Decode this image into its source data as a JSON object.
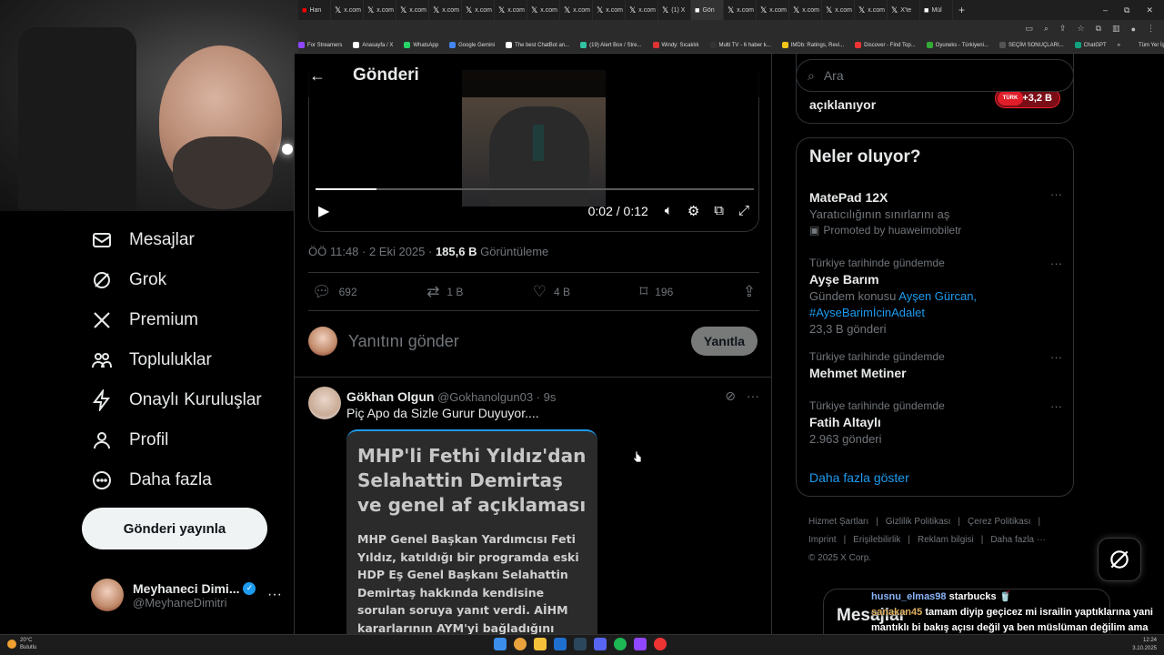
{
  "browser": {
    "tabs": [
      {
        "icon": "yt",
        "label": "Han",
        "color": "#ff0000"
      },
      {
        "icon": "x",
        "label": "x.com"
      },
      {
        "icon": "x",
        "label": "x.com"
      },
      {
        "icon": "x",
        "label": "x.com"
      },
      {
        "icon": "x",
        "label": "x.com"
      },
      {
        "icon": "x",
        "label": "x.com"
      },
      {
        "icon": "x",
        "label": "x.com"
      },
      {
        "icon": "x",
        "label": "x.com"
      },
      {
        "icon": "x",
        "label": "x.com"
      },
      {
        "icon": "x",
        "label": "x.com"
      },
      {
        "icon": "x",
        "label": "x.com"
      },
      {
        "icon": "x",
        "label": "(1) X"
      },
      {
        "icon": "g",
        "label": "Gön"
      },
      {
        "icon": "x",
        "label": "x.com"
      },
      {
        "icon": "x",
        "label": "x.com"
      },
      {
        "icon": "x",
        "label": "x.com"
      },
      {
        "icon": "x",
        "label": "x.com"
      },
      {
        "icon": "x",
        "label": "x.com"
      },
      {
        "icon": "x",
        "label": "X'te"
      },
      {
        "icon": "m",
        "label": "Mül"
      }
    ],
    "new_tab": "+",
    "window_controls": [
      "–",
      "⧉",
      "✕"
    ],
    "bookmarks": [
      {
        "label": "For Streamers",
        "color": "#9146ff"
      },
      {
        "label": "Anasayfa / X",
        "color": "#ffffff"
      },
      {
        "label": "WhatsApp",
        "color": "#25d366"
      },
      {
        "label": "Google Gemini",
        "color": "#4285f4"
      },
      {
        "label": "The best ChatBot an...",
        "color": "#ffffff"
      },
      {
        "label": "(19) Alert Box / Stre...",
        "color": "#31c3a2"
      },
      {
        "label": "Windy: Sıcaklık",
        "color": "#d33"
      },
      {
        "label": "Multi TV - 6 haber k...",
        "color": "#333"
      },
      {
        "label": "IMDb: Ratings, Revi...",
        "color": "#f5c518"
      },
      {
        "label": "Discover - Find Top...",
        "color": "#e33"
      },
      {
        "label": "Oyuneks - Türkiyeni...",
        "color": "#3a3"
      },
      {
        "label": "SEÇİM SONUÇLARI...",
        "color": "#555"
      },
      {
        "label": "ChatGPT",
        "color": "#10a37f"
      }
    ],
    "bookmarks_more": "»",
    "all_bookmarks": "Tüm Yer İşaretleri"
  },
  "nav": {
    "items": [
      {
        "label": "Mesajlar",
        "icon": "mail-icon"
      },
      {
        "label": "Grok",
        "icon": "grok-icon"
      },
      {
        "label": "Premium",
        "icon": "x-logo-icon"
      },
      {
        "label": "Topluluklar",
        "icon": "communities-icon"
      },
      {
        "label": "Onaylı Kuruluşlar",
        "icon": "lightning-icon"
      },
      {
        "label": "Profil",
        "icon": "person-icon"
      },
      {
        "label": "Daha fazla",
        "icon": "more-circle-icon"
      }
    ],
    "post_button": "Gönderi yayınla",
    "profile": {
      "name": "Meyhaneci Dimi...",
      "handle": "@MeyhaneDimitri",
      "more": "···"
    }
  },
  "main": {
    "header_title": "Gönderi",
    "video": {
      "time": "0:02 / 0:12",
      "progress": 0.14
    },
    "meta": {
      "time": "ÖÖ 11:48 · 2 Eki 2025 · ",
      "views": "185,6 B",
      "views_label": " Görüntüleme"
    },
    "actions": {
      "replies": "692",
      "reposts": "1 B",
      "likes": "4 B",
      "bookmarks": "196"
    },
    "reply": {
      "placeholder": "Yanıtını gönder",
      "button": "Yanıtla"
    },
    "reply_tweet": {
      "name": "Gökhan Olgun",
      "handle": "@Gokhanolgun03 · 9s",
      "text": "Piç Apo da Sizle Gurur Duyuyor....",
      "card_title": "MHP'li Fethi Yıldız'dan Selahattin Demirtaş ve genel af açıklaması",
      "card_body": "MHP Genel Başkan Yardımcısı Feti Yıldız, katıldığı bir programda eski HDP Eş Genel Başkanı Selahattin Demirtaş hakkında kendisine sorulan soruya yanıt verdi. AİHM kararlarının AYM'yi bağladığını ifade eden Yıldız, \"Elbette bazı şeyler yapmak"
    }
  },
  "right": {
    "search_placeholder": "Ara",
    "prev_card": {
      "title": "açıklanıyor",
      "badge": "+3,2 B",
      "badge_logo": "TÜRK"
    },
    "trends_title": "Neler oluyor?",
    "trends": [
      {
        "context": "",
        "name": "MatePad 12X",
        "sub": "Yaratıcılığının sınırlarını aş",
        "promo": "Promoted by huaweimobiletr"
      },
      {
        "context": "Türkiye tarihinde gündemde",
        "name": "Ayşe Barım",
        "sub_prefix": "Gündem konusu ",
        "sub_link1": "Ayşen Gürcan,",
        "sub_link2": "#AyseBarimİcinAdalet",
        "count": "23,3 B gönderi"
      },
      {
        "context": "Türkiye tarihinde gündemde",
        "name": "Mehmet Metiner"
      },
      {
        "context": "Türkiye tarihinde gündemde",
        "name": "Fatih Altaylı",
        "count": "2.963 gönderi"
      }
    ],
    "show_more": "Daha fazla göster",
    "footer": [
      "Hizmet Şartları",
      "|",
      "Gizlilik Politikası",
      "|",
      "Çerez Politikası",
      "|",
      "Imprint",
      "|",
      "Erişilebilirlik",
      "|",
      "Reklam bilgisi",
      "|",
      "Daha fazla ···",
      "© 2025 X Corp."
    ],
    "messages_drawer": "Mesajlar"
  },
  "chat": [
    {
      "user": "husnu_elmas98",
      "text": "starbucks 🥤"
    },
    {
      "user": "sanakan45",
      "text": "tamam diyip geçicez mi israilin yaptıklarına yani mantıklı bi bakış açısı değil ya ben müslüman değilim ama böyle.düşünüyorum"
    }
  ],
  "taskbar": {
    "weather_temp": "20°C",
    "weather_desc": "Bulutlu",
    "time": "12:24",
    "date": "3.10.2025"
  }
}
